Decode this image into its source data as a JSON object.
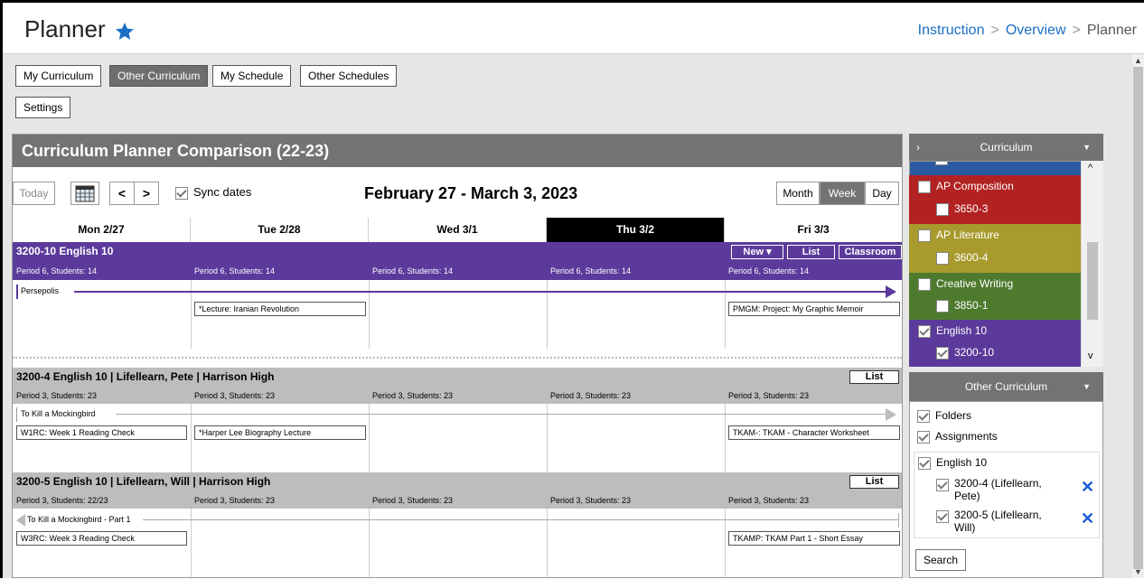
{
  "header": {
    "title": "Planner",
    "breadcrumbs": [
      "Instruction",
      "Overview",
      "Planner"
    ]
  },
  "tabs": [
    "My Curriculum",
    "Other Curriculum",
    "My Schedule",
    "Other Schedules"
  ],
  "settings_label": "Settings",
  "comparison": {
    "title": "Curriculum Planner Comparison (22-23)",
    "today_label": "Today",
    "sync_label": "Sync dates",
    "range": "February 27 - March 3, 2023",
    "views": [
      "Month",
      "Week",
      "Day"
    ],
    "days": [
      "Mon 2/27",
      "Tue 2/28",
      "Wed 3/1",
      "Thu 3/2",
      "Fri 3/3"
    ],
    "sections": [
      {
        "title": "3200-10 English 10",
        "buttons": [
          "New ▾",
          "List",
          "Classroom"
        ],
        "periods": [
          "Period 6, Students: 14",
          "Period 6, Students: 14",
          "Period 6, Students: 14",
          "Period 6, Students: 14",
          "Period 6, Students: 14"
        ],
        "unit": "Persepolis",
        "lessons": [
          "*Lecture: Iranian Revolution",
          "PMGM: Project: My Graphic Memoir"
        ]
      },
      {
        "title": "3200-4 English 10 | Lifellearn, Pete | Harrison High",
        "buttons": [
          "List"
        ],
        "periods": [
          "Period 3, Students: 23",
          "Period 3, Students: 23",
          "Period 3, Students: 23",
          "Period 3, Students: 23",
          "Period 3, Students: 23"
        ],
        "unit": "To Kill a Mockingbird",
        "lessons": [
          "W1RC: Week 1 Reading Check",
          "*Harper Lee Biography Lecture",
          "TKAM-: TKAM - Character Worksheet"
        ]
      },
      {
        "title": "3200-5 English 10 | Lifellearn, Will | Harrison High",
        "buttons": [
          "List"
        ],
        "periods": [
          "Period 3, Students: 22/23",
          "Period 3, Students: 23",
          "Period 3, Students: 23",
          "Period 3, Students: 23",
          "Period 3, Students: 23"
        ],
        "unit": "To Kill a Mockingbird - Part 1",
        "lessons": [
          "W3RC: Week 3 Reading Check",
          "TKAMP: TKAM Part 1 - Short Essay"
        ]
      }
    ]
  },
  "curriculum_panel": {
    "title": "Curriculum",
    "items": [
      {
        "name": "AP Composition",
        "sub": "3650-3",
        "color": "#b22222"
      },
      {
        "name": "AP Literature",
        "sub": "3600-4",
        "color": "#a89a2c"
      },
      {
        "name": "Creative Writing",
        "sub": "3850-1",
        "color": "#4e7a2e"
      },
      {
        "name": "English 10",
        "sub": "3200-10",
        "color": "#5b3a9b"
      }
    ]
  },
  "other_panel": {
    "title": "Other Curriculum",
    "options": [
      "Folders",
      "Assignments"
    ],
    "group": "English 10",
    "entries": [
      "3200-4 (Lifellearn, Pete)",
      "3200-5 (Lifellearn, Will)"
    ],
    "search_label": "Search"
  }
}
